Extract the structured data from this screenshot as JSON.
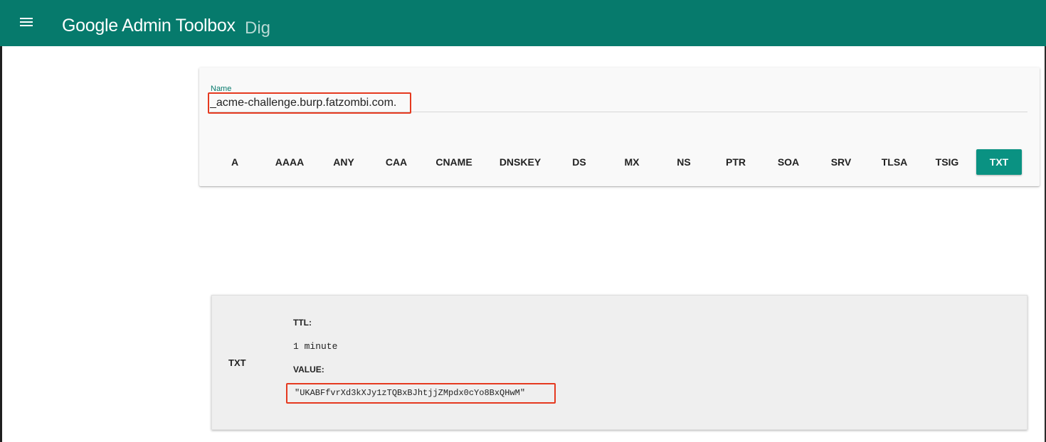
{
  "app": {
    "title": "Google Admin Toolbox",
    "subtitle": "Dig",
    "menu_icon": "hamburger-menu-icon",
    "header_color": "#067a6c"
  },
  "query": {
    "name_label": "Name",
    "name_value": "_acme-challenge.burp.fatzombi.com.",
    "record_types": [
      "A",
      "AAAA",
      "ANY",
      "CAA",
      "CNAME",
      "DNSKEY",
      "DS",
      "MX",
      "NS",
      "PTR",
      "SOA",
      "SRV",
      "TLSA",
      "TSIG",
      "TXT"
    ],
    "selected_type": "TXT",
    "accent_color": "#0a9282"
  },
  "result": {
    "record_type": "TXT",
    "ttl_label": "TTL:",
    "ttl_value": "1 minute",
    "value_label": "VALUE:",
    "value": "\"UKABFfvrXd3kXJy1zTQBxBJhtjjZMpdx0cYo8BxQHwM\""
  },
  "annotations": {
    "highlight_color": "#e5391f"
  }
}
